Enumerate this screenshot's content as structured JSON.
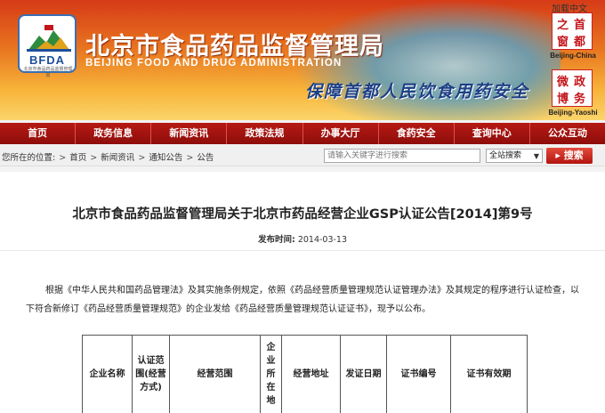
{
  "header": {
    "logo_abbr": "BFDA",
    "title_cn": "北京市食品药品监督管理局",
    "title_en": "BEIJING FOOD AND DRUG ADMINISTRATION",
    "slogan": "保障首都人民饮食用药安全",
    "top_link": "加载中文",
    "seal_top_chars": [
      "首",
      "都",
      "之",
      "窗"
    ],
    "seal_top_caption": "Beijing-China",
    "seal_bottom_chars": [
      "政",
      "务",
      "微",
      "博"
    ],
    "seal_bottom_caption": "Beijing-Yaoshi"
  },
  "nav": {
    "items": [
      "首页",
      "政务信息",
      "新闻资讯",
      "政策法规",
      "办事大厅",
      "食药安全",
      "查询中心",
      "公众互动"
    ]
  },
  "breadcrumb": {
    "prefix": "您所在的位置:",
    "items": [
      "首页",
      "新闻资讯",
      "通知公告",
      "公告"
    ]
  },
  "search": {
    "placeholder": "请输入关键字进行搜索",
    "scope": "全站搜索",
    "button": "搜索"
  },
  "article": {
    "title": "北京市食品药品监督管理局关于北京市药品经营企业GSP认证公告[2014]第9号",
    "date_label": "发布时间:",
    "date": "2014-03-13",
    "paragraph": "根据《中华人民共和国药品管理法》及其实施条例规定，依照《药品经营质量管理规范认证管理办法》及其规定的程序进行认证检查，以下符合新修订《药品经营质量管理规范》的企业发给《药品经营质量管理规范认证证书》，现予以公布。"
  },
  "table": {
    "headers": [
      "企业名称",
      "认证范围(经营方式)",
      "经营范围",
      "企业所在地",
      "经营地址",
      "发证日期",
      "证书编号",
      "证书有效期"
    ]
  }
}
